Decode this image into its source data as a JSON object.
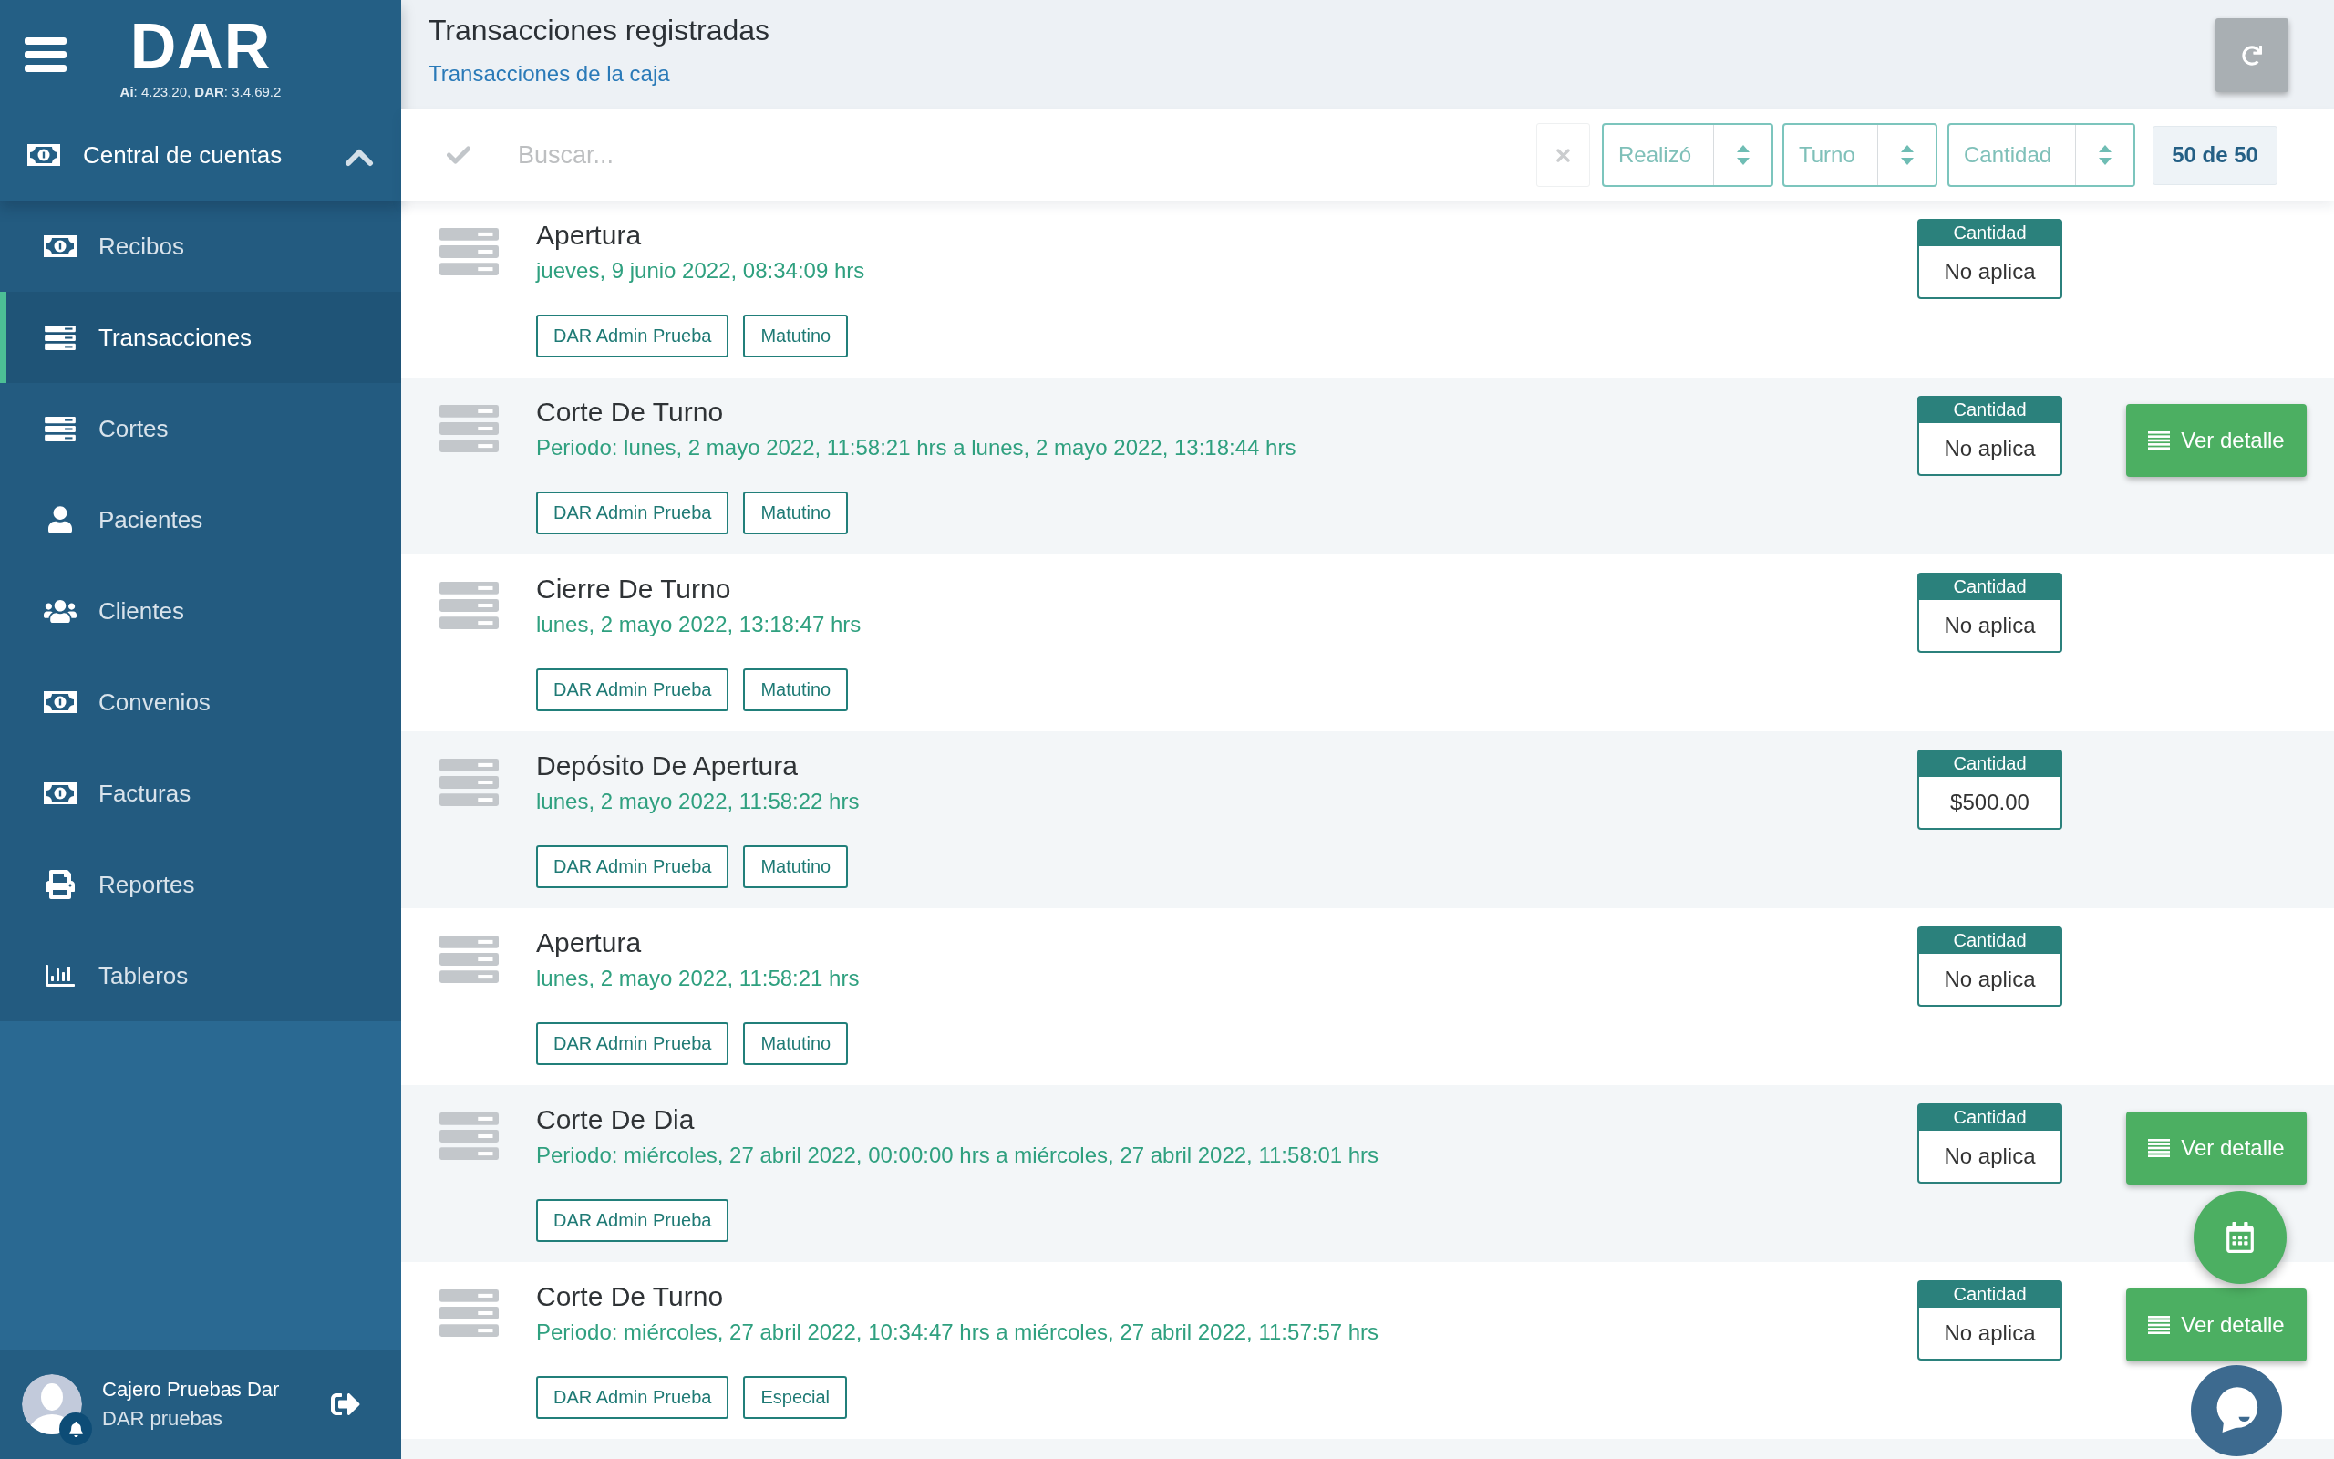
{
  "sidebar": {
    "logo": "DAR",
    "version": "**Ai**: 4.23.20, **DAR**: 3.4.69.2",
    "section": {
      "label": "Central de cuentas",
      "expanded": true
    },
    "items": [
      {
        "label": "Recibos",
        "kind": "bill",
        "selected": false
      },
      {
        "label": "Transacciones",
        "kind": "stack",
        "selected": true
      },
      {
        "label": "Cortes",
        "kind": "stack",
        "selected": false
      },
      {
        "label": "Pacientes",
        "kind": "person",
        "selected": false
      },
      {
        "label": "Clientes",
        "kind": "group",
        "selected": false
      },
      {
        "label": "Convenios",
        "kind": "bill",
        "selected": false
      },
      {
        "label": "Facturas",
        "kind": "bill",
        "selected": false
      },
      {
        "label": "Reportes",
        "kind": "printer",
        "selected": false
      },
      {
        "label": "Tableros",
        "kind": "chart",
        "selected": false
      }
    ],
    "user": {
      "name": "Cajero Pruebas Dar",
      "role": "DAR pruebas"
    }
  },
  "header": {
    "title": "Transacciones registradas",
    "subtitle": "Transacciones de la caja"
  },
  "toolbar": {
    "search": {
      "placeholder": "Buscar..."
    },
    "filters": [
      {
        "placeholder": "Realizó"
      },
      {
        "placeholder": "Turno"
      },
      {
        "placeholder": "Cantidad"
      }
    ],
    "count": "50 de 50"
  },
  "transactions": [
    {
      "title": "Apertura",
      "date": "jueves, 9 junio 2022, 08:34:09 hrs",
      "tags": [
        "DAR Admin Prueba",
        "Matutino"
      ],
      "amount_label": "Cantidad",
      "amount": "No aplica"
    },
    {
      "title": "Corte De Turno",
      "date": "Periodo: lunes, 2 mayo 2022, 11:58:21 hrs a lunes, 2 mayo 2022, 13:18:44 hrs",
      "tags": [
        "DAR Admin Prueba",
        "Matutino"
      ],
      "amount_label": "Cantidad",
      "amount": "No aplica",
      "action": "Ver detalle"
    },
    {
      "title": "Cierre De Turno",
      "date": "lunes, 2 mayo 2022, 13:18:47 hrs",
      "tags": [
        "DAR Admin Prueba",
        "Matutino"
      ],
      "amount_label": "Cantidad",
      "amount": "No aplica"
    },
    {
      "title": "Depósito De Apertura",
      "date": "lunes, 2 mayo 2022, 11:58:22 hrs",
      "tags": [
        "DAR Admin Prueba",
        "Matutino"
      ],
      "amount_label": "Cantidad",
      "amount": "$500.00"
    },
    {
      "title": "Apertura",
      "date": "lunes, 2 mayo 2022, 11:58:21 hrs",
      "tags": [
        "DAR Admin Prueba",
        "Matutino"
      ],
      "amount_label": "Cantidad",
      "amount": "No aplica"
    },
    {
      "title": "Corte De Dia",
      "date": "Periodo: miércoles, 27 abril 2022, 00:00:00 hrs a miércoles, 27 abril 2022, 11:58:01 hrs",
      "tags": [
        "DAR Admin Prueba"
      ],
      "amount_label": "Cantidad",
      "amount": "No aplica",
      "action": "Ver detalle"
    },
    {
      "title": "Corte De Turno",
      "date": "Periodo: miércoles, 27 abril 2022, 10:34:47 hrs a miércoles, 27 abril 2022, 11:57:57 hrs",
      "tags": [
        "DAR Admin Prueba",
        "Especial"
      ],
      "amount_label": "Cantidad",
      "amount": "No aplica",
      "action": "Ver detalle"
    }
  ]
}
